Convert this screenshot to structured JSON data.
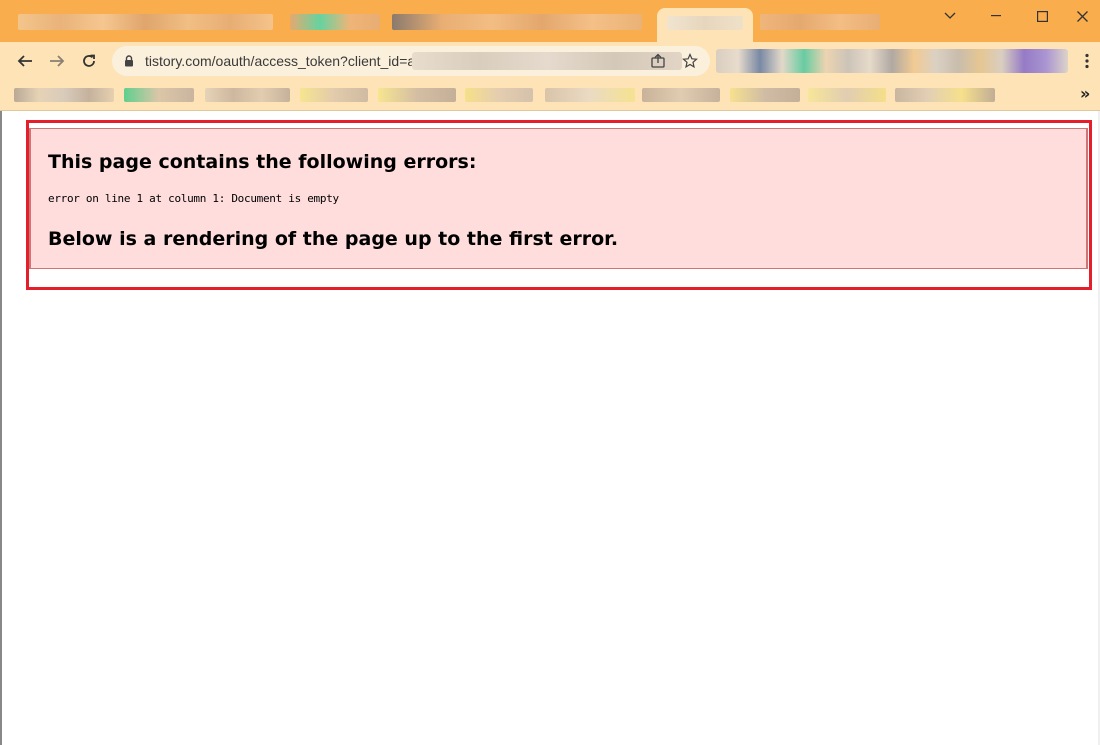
{
  "browser": {
    "url_visible": "tistory.com/oauth/access_token?client_id=a",
    "window_controls": {
      "tab_search_icon": "chevron-down-icon",
      "minimize_icon": "minimize-icon",
      "maximize_icon": "maximize-icon",
      "close_icon": "close-icon"
    },
    "nav_icons": [
      "back-arrow-icon",
      "forward-arrow-icon",
      "reload-icon"
    ],
    "bookmarks_overflow": "»",
    "accent_color": "#f9ad4d"
  },
  "page": {
    "error_title": "This page contains the following errors:",
    "error_detail": "error on line 1 at column 1: Document is empty",
    "error_footer": "Below is a rendering of the page up to the first error.",
    "error_bg": "#ffdddd",
    "highlight_color": "#e41e2a"
  }
}
